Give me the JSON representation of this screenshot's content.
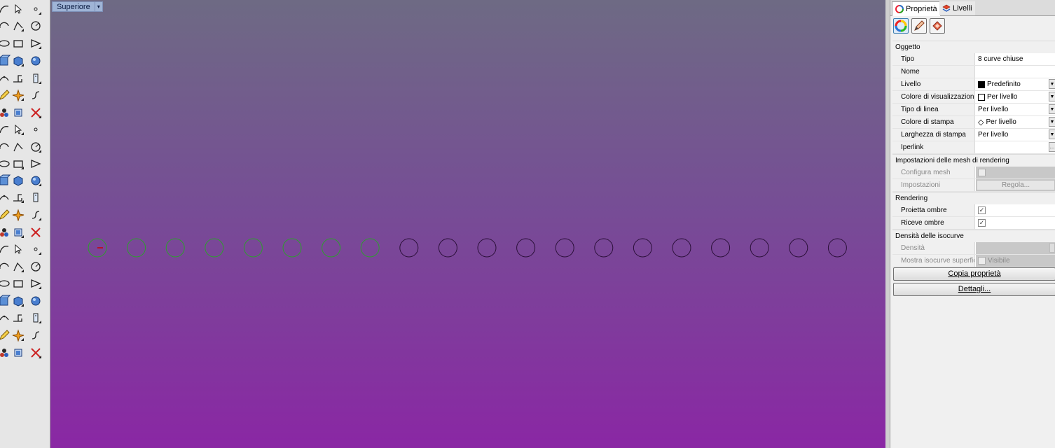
{
  "viewport": {
    "label": "Superiore",
    "dropdown_glyph": "▾",
    "colors": {
      "selected": "#2ca02c",
      "unselected": "#2a0f38",
      "origin_tick": "#cc0000"
    },
    "circles": [
      {
        "selected": true
      },
      {
        "selected": true
      },
      {
        "selected": true
      },
      {
        "selected": true
      },
      {
        "selected": true
      },
      {
        "selected": true
      },
      {
        "selected": true
      },
      {
        "selected": true
      },
      {
        "selected": false
      },
      {
        "selected": false
      },
      {
        "selected": false
      },
      {
        "selected": false
      },
      {
        "selected": false
      },
      {
        "selected": false
      },
      {
        "selected": false
      },
      {
        "selected": false
      },
      {
        "selected": false
      },
      {
        "selected": false
      },
      {
        "selected": false
      },
      {
        "selected": false
      }
    ]
  },
  "toolbar": {
    "icons": [
      [
        "curve-icon",
        "select-arrow-icon",
        "point-icon"
      ],
      [
        "arc-icon",
        "polyline-icon",
        "curve-edit-icon"
      ],
      [
        "triangle-icon",
        "circle-icon",
        "ellipse-icon"
      ],
      [
        "arc-tool-icon",
        "polygon-icon",
        "rectangle-icon"
      ],
      [
        "surface-icon",
        "circle-center-icon",
        "fillet-icon"
      ],
      [
        "box-icon",
        "extrude-icon",
        "offset-icon"
      ],
      [
        "cylinder-icon",
        "solid-box-icon",
        "sphere-icon"
      ],
      [
        "gear-icon",
        "cylinder-solid-icon",
        "plane-icon"
      ],
      [
        "split-icon",
        "boolean-icon",
        "explode-icon"
      ],
      [
        "sphere-set-icon",
        "bend-icon",
        "cap-icon"
      ],
      [
        "join-icon",
        "shade-icon",
        "spheres-icon"
      ],
      [
        "text-icon",
        "curve-trim-icon",
        "fillet-edge-icon"
      ],
      [
        "cube-icon",
        "text-object-icon",
        "dimension-icon"
      ],
      [
        "array-icon",
        "box-edit-icon",
        "hatch-icon"
      ],
      [
        "rotate-icon",
        "block-icon",
        "grid-icon"
      ],
      [
        "lamp-icon",
        "array-grid-icon",
        "layer-icon"
      ],
      [
        "undo-curve-icon",
        "clipboard-icon",
        "check-icon"
      ],
      [
        "trim-icon",
        "wedge-icon",
        "render-icon"
      ],
      [
        "blend-icon",
        "move-icon",
        "material-icon"
      ],
      [
        "flow-icon",
        "cube-render-icon",
        "settings-icon"
      ],
      [
        "network-icon",
        "hide-icon",
        "delete-icon"
      ]
    ]
  },
  "panel": {
    "tabs": [
      {
        "label": "Proprietà",
        "icon": "properties-icon",
        "active": true
      },
      {
        "label": "Livelli",
        "icon": "layers-icon",
        "active": false
      }
    ],
    "sections": [
      {
        "title": "Oggetto",
        "rows": [
          {
            "label": "Tipo",
            "value": "8 curve chiuse"
          },
          {
            "label": "Nome",
            "value": ""
          },
          {
            "label": "Livello",
            "value": "Predefinito",
            "swatch": "black",
            "dropdown": true
          },
          {
            "label": "Colore di visualizzazione",
            "value": "Per livello",
            "swatch": "white",
            "dropdown": true
          },
          {
            "label": "Tipo di linea",
            "value": "Per livello",
            "dropdown": true
          },
          {
            "label": "Colore di stampa",
            "value": "Per livello",
            "diamond": true,
            "dropdown": true
          },
          {
            "label": "Larghezza di stampa",
            "value": "Per livello",
            "dropdown": true
          },
          {
            "label": "Iperlink",
            "value": "",
            "ellipsis": true
          }
        ]
      },
      {
        "title": "Impostazioni delle mesh di rendering",
        "rows": [
          {
            "label": "Configura mesh",
            "value": "",
            "checkbox": false,
            "disabled": true
          },
          {
            "label": "Impostazioni",
            "value": "",
            "button": "Regola...",
            "disabled": true
          }
        ]
      },
      {
        "title": "Rendering",
        "rows": [
          {
            "label": "Proietta ombre",
            "value": "",
            "checkbox": true
          },
          {
            "label": "Riceve ombre",
            "value": "",
            "checkbox": true
          }
        ]
      },
      {
        "title": "Densità delle isocurve",
        "rows": [
          {
            "label": "Densità",
            "value": "",
            "spin": true,
            "disabled": true
          },
          {
            "label": "Mostra isocurve superfici",
            "value": "Visibile",
            "checkbox": false,
            "disabled": true
          }
        ]
      }
    ],
    "buttons": {
      "copy": "Copia proprietà",
      "details": "Dettagli..."
    },
    "icon_buttons": [
      "color-wheel-icon",
      "pencil-icon",
      "render-texture-icon"
    ]
  }
}
